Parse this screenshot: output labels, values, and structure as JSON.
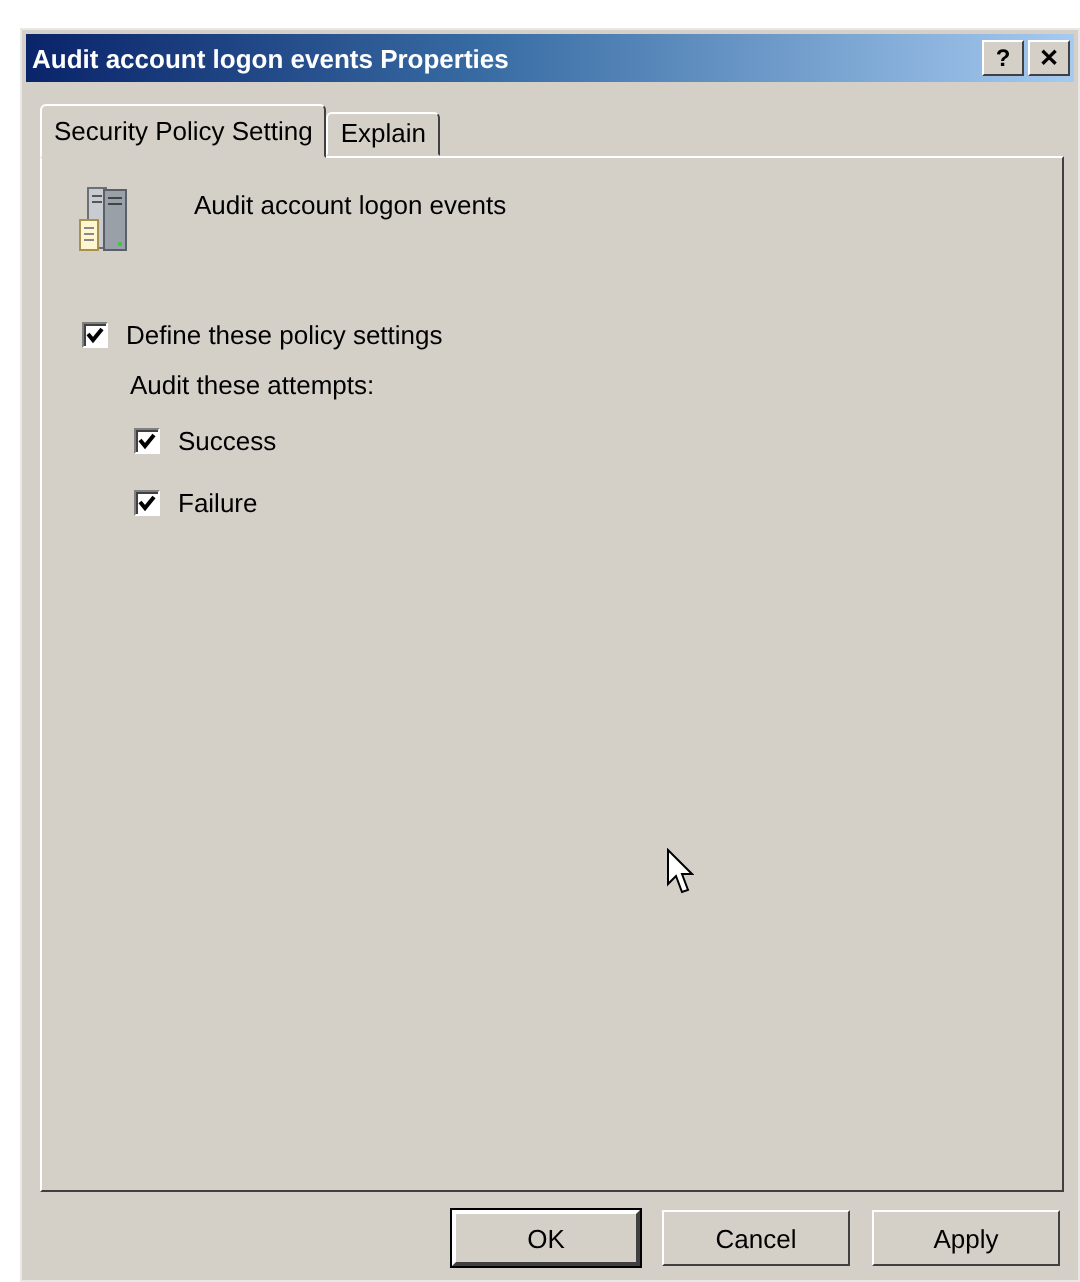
{
  "window": {
    "title": "Audit account logon events Properties",
    "title_buttons": [
      "?",
      "✕"
    ]
  },
  "tabs": [
    {
      "label": "Security Policy Setting",
      "selected": true
    },
    {
      "label": "Explain",
      "selected": false
    }
  ],
  "policy_name": "Audit account logon events",
  "define": {
    "label": "Define these policy settings",
    "checked": true
  },
  "attempts_label": "Audit these attempts:",
  "attempts": [
    {
      "label": "Success",
      "checked": true
    },
    {
      "label": "Failure",
      "checked": true
    }
  ],
  "buttons": [
    {
      "label": "OK",
      "default": true
    },
    {
      "label": "Cancel",
      "default": false
    },
    {
      "label": "Apply",
      "default": false
    }
  ]
}
